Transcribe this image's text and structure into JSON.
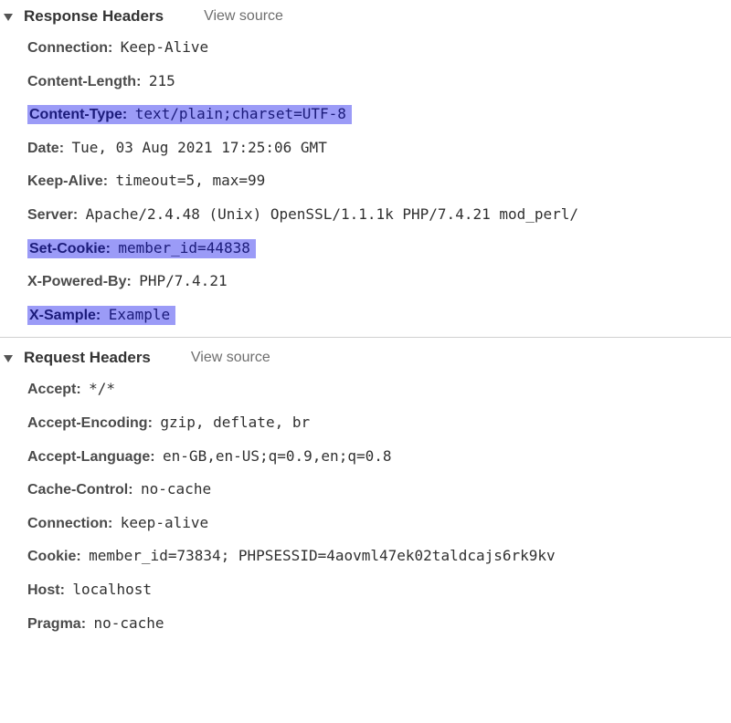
{
  "sections": {
    "response": {
      "title": "Response Headers",
      "view_source": "View source",
      "headers": [
        {
          "name": "Connection",
          "value": "Keep-Alive",
          "highlight": false
        },
        {
          "name": "Content-Length",
          "value": "215",
          "highlight": false
        },
        {
          "name": "Content-Type",
          "value": "text/plain;charset=UTF-8",
          "highlight": true
        },
        {
          "name": "Date",
          "value": "Tue, 03 Aug 2021 17:25:06 GMT",
          "highlight": false
        },
        {
          "name": "Keep-Alive",
          "value": "timeout=5, max=99",
          "highlight": false
        },
        {
          "name": "Server",
          "value": "Apache/2.4.48 (Unix) OpenSSL/1.1.1k PHP/7.4.21 mod_perl/",
          "highlight": false
        },
        {
          "name": "Set-Cookie",
          "value": "member_id=44838",
          "highlight": true
        },
        {
          "name": "X-Powered-By",
          "value": "PHP/7.4.21",
          "highlight": false
        },
        {
          "name": "X-Sample",
          "value": "Example",
          "highlight": true
        }
      ]
    },
    "request": {
      "title": "Request Headers",
      "view_source": "View source",
      "headers": [
        {
          "name": "Accept",
          "value": "*/*",
          "highlight": false
        },
        {
          "name": "Accept-Encoding",
          "value": "gzip, deflate, br",
          "highlight": false
        },
        {
          "name": "Accept-Language",
          "value": "en-GB,en-US;q=0.9,en;q=0.8",
          "highlight": false
        },
        {
          "name": "Cache-Control",
          "value": "no-cache",
          "highlight": false
        },
        {
          "name": "Connection",
          "value": "keep-alive",
          "highlight": false
        },
        {
          "name": "Cookie",
          "value": "member_id=73834; PHPSESSID=4aovml47ek02taldcajs6rk9kv",
          "highlight": false
        },
        {
          "name": "Host",
          "value": "localhost",
          "highlight": false
        },
        {
          "name": "Pragma",
          "value": "no-cache",
          "highlight": false
        }
      ]
    }
  }
}
